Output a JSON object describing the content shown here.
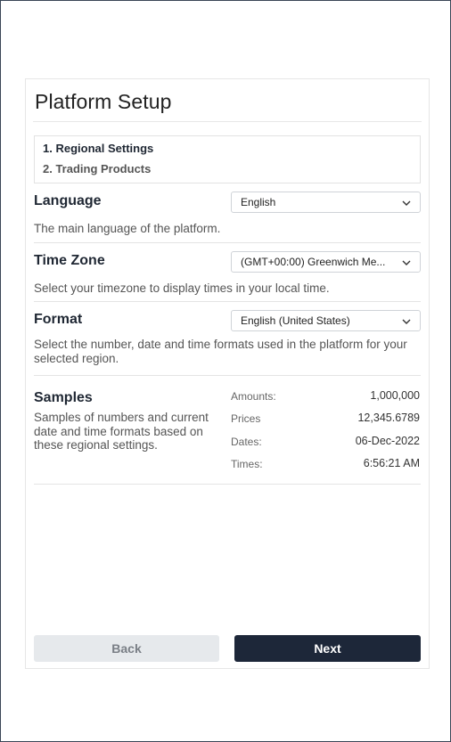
{
  "page": {
    "title": "Platform Setup"
  },
  "steps": [
    {
      "label": "1. Regional Settings",
      "active": true
    },
    {
      "label": "2. Trading Products",
      "active": false
    }
  ],
  "settings": {
    "language": {
      "label": "Language",
      "value": "English",
      "description": "The main language of the platform."
    },
    "timezone": {
      "label": "Time Zone",
      "value": "(GMT+00:00) Greenwich Me...",
      "description": "Select your timezone to display times in your local time."
    },
    "format": {
      "label": "Format",
      "value": "English (United States)",
      "description": "Select the number, date and time formats used in the platform for your selected region."
    }
  },
  "samples": {
    "label": "Samples",
    "description": "Samples of numbers and current date and time formats based on these regional settings.",
    "items": [
      {
        "key": "Amounts:",
        "value": "1,000,000"
      },
      {
        "key": "Prices",
        "value": "12,345.6789"
      },
      {
        "key": "Dates:",
        "value": "06-Dec-2022"
      },
      {
        "key": "Times:",
        "value": "6:56:21 AM"
      }
    ]
  },
  "buttons": {
    "back": "Back",
    "next": "Next"
  },
  "colors": {
    "primary_button": "#1d2739",
    "disabled_button": "#e6e9ec",
    "border": "#e4e4e4"
  },
  "icons": {
    "dropdown": "chevron-down-icon"
  }
}
